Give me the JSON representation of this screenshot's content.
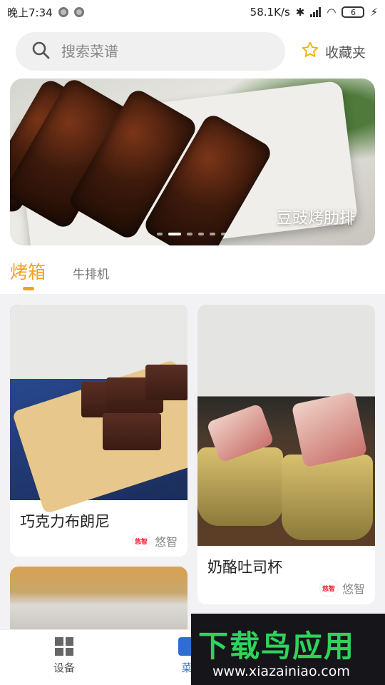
{
  "status_bar": {
    "time": "晚上7:34",
    "net_speed": "58.1K/s",
    "battery": "6"
  },
  "search": {
    "placeholder": "搜索菜谱",
    "favorites_label": "收藏夹"
  },
  "banner": {
    "title": "豆豉烤肋排",
    "page_count": 6,
    "active_page": 1
  },
  "tabs": [
    {
      "label": "烤箱",
      "active": true
    },
    {
      "label": "牛排机",
      "active": false
    }
  ],
  "recipes": [
    {
      "title": "巧克力布朗尼",
      "author": "悠智",
      "author_logo_text": "悠智"
    },
    {
      "title": "奶酪吐司杯",
      "author": "悠智",
      "author_logo_text": "悠智"
    }
  ],
  "bottom_nav": [
    {
      "label": "设备",
      "icon": "grid-icon"
    },
    {
      "label": "菜",
      "icon": "book-icon"
    }
  ],
  "watermark": {
    "brand": "下载鸟应用",
    "url": "www.xiazainiao.com"
  },
  "colors": {
    "accent": "#f0a220",
    "nav_active": "#2b6fd6",
    "watermark_green": "#2fd35a"
  }
}
